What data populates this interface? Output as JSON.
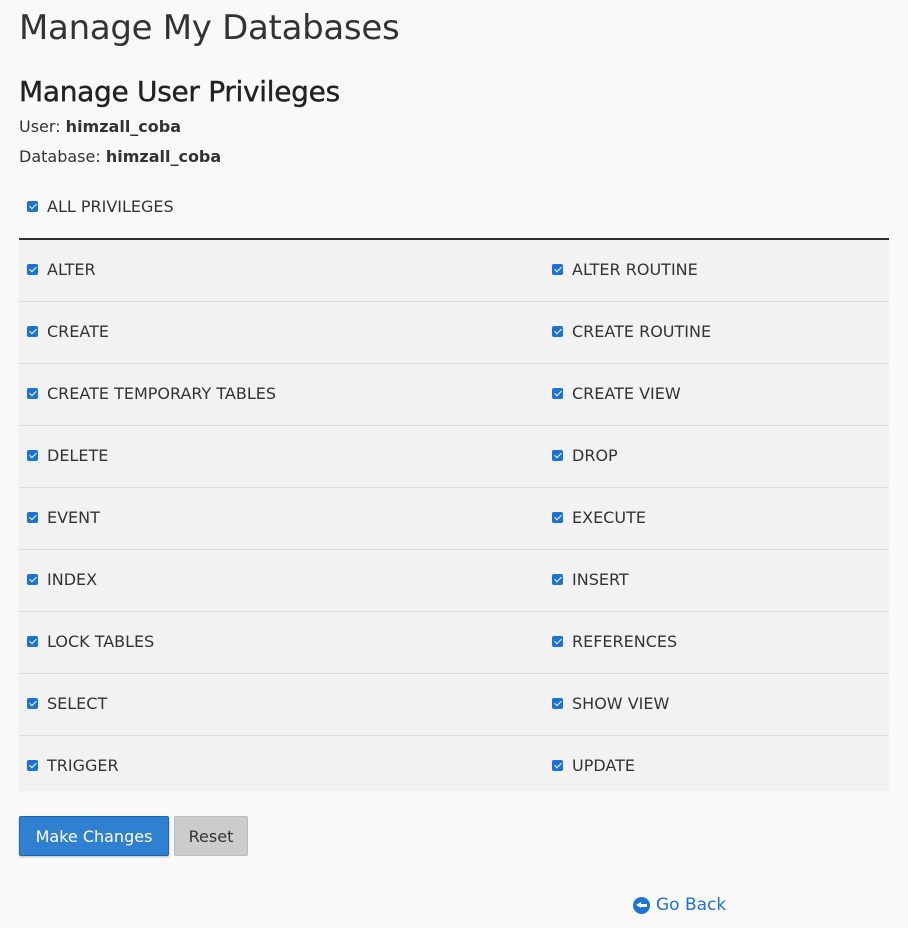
{
  "page": {
    "title": "Manage My Databases"
  },
  "section": {
    "title": "Manage User Privileges",
    "user_label": "User:",
    "user_value": "himzall_coba",
    "database_label": "Database:",
    "database_value": "himzall_coba"
  },
  "all_privileges": {
    "label": "ALL PRIVILEGES",
    "checked": true
  },
  "privileges": {
    "rows": [
      {
        "left": {
          "label": "ALTER",
          "checked": true
        },
        "right": {
          "label": "ALTER ROUTINE",
          "checked": true
        }
      },
      {
        "left": {
          "label": "CREATE",
          "checked": true
        },
        "right": {
          "label": "CREATE ROUTINE",
          "checked": true
        }
      },
      {
        "left": {
          "label": "CREATE TEMPORARY TABLES",
          "checked": true
        },
        "right": {
          "label": "CREATE VIEW",
          "checked": true
        }
      },
      {
        "left": {
          "label": "DELETE",
          "checked": true
        },
        "right": {
          "label": "DROP",
          "checked": true
        }
      },
      {
        "left": {
          "label": "EVENT",
          "checked": true
        },
        "right": {
          "label": "EXECUTE",
          "checked": true
        }
      },
      {
        "left": {
          "label": "INDEX",
          "checked": true
        },
        "right": {
          "label": "INSERT",
          "checked": true
        }
      },
      {
        "left": {
          "label": "LOCK TABLES",
          "checked": true
        },
        "right": {
          "label": "REFERENCES",
          "checked": true
        }
      },
      {
        "left": {
          "label": "SELECT",
          "checked": true
        },
        "right": {
          "label": "SHOW VIEW",
          "checked": true
        }
      },
      {
        "left": {
          "label": "TRIGGER",
          "checked": true
        },
        "right": {
          "label": "UPDATE",
          "checked": true
        }
      }
    ]
  },
  "actions": {
    "submit_label": "Make Changes",
    "reset_label": "Reset",
    "go_back_label": "Go Back",
    "go_back_icon": "circle-arrow-left-icon"
  },
  "colors": {
    "accent": "#2f80d1",
    "link": "#1b74d6",
    "checkbox": "#1a73d9",
    "background": "#f9f9f9",
    "row_background": "#f2f2f2"
  }
}
